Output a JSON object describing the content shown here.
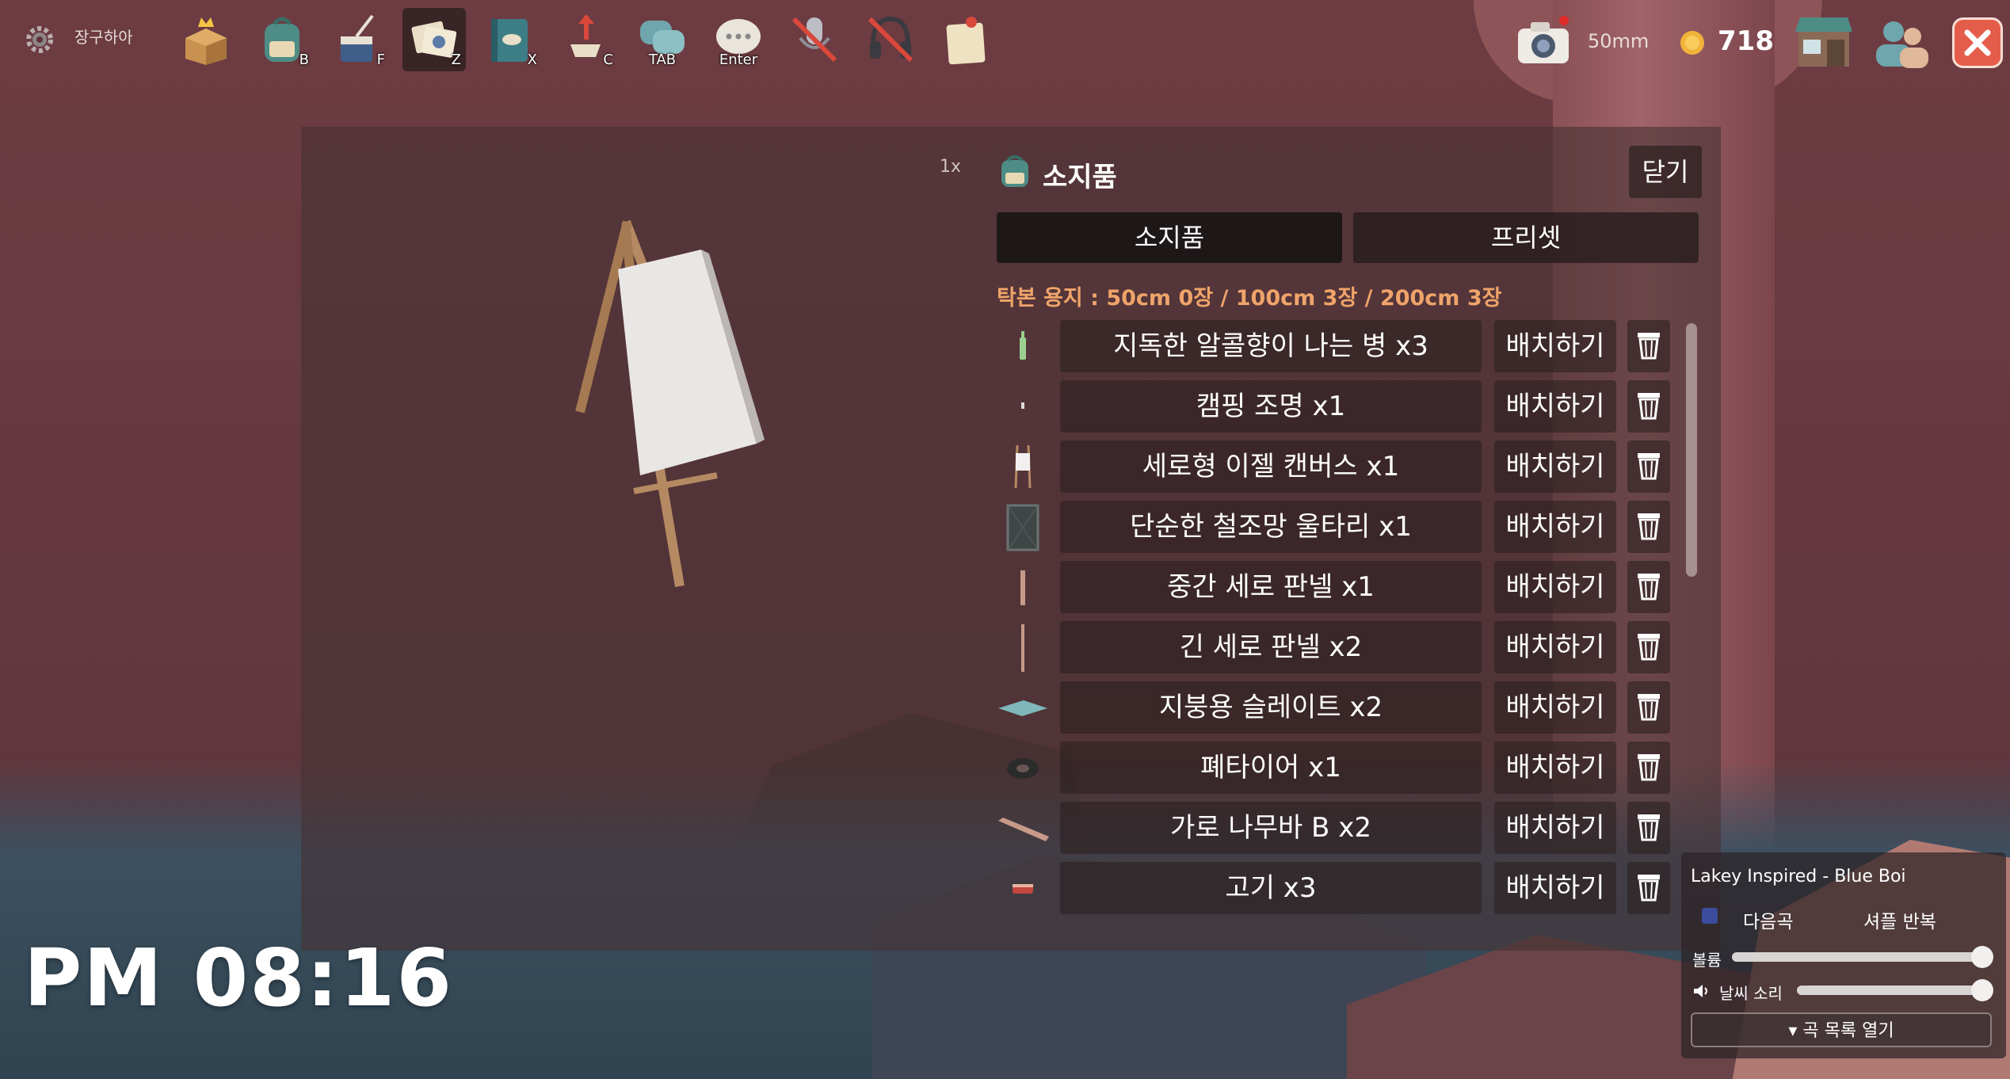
{
  "toolbar": {
    "settings_label": "장구하아",
    "buttons": [
      {
        "icon": "crown-box-icon",
        "key": ""
      },
      {
        "icon": "backpack-icon",
        "key": "B"
      },
      {
        "icon": "fishing-bucket-icon",
        "key": "F"
      },
      {
        "icon": "photo-album-icon",
        "key": "Z"
      },
      {
        "icon": "fish-encyclopedia-icon",
        "key": "X"
      },
      {
        "icon": "chair-move-icon",
        "key": "C"
      },
      {
        "icon": "chat-bubbles-icon",
        "key": "TAB"
      },
      {
        "icon": "speech-bubble-icon",
        "key": "Enter"
      },
      {
        "icon": "microphone-muted-icon",
        "key": ""
      },
      {
        "icon": "headphones-muted-icon",
        "key": ""
      },
      {
        "icon": "memo-pin-icon",
        "key": ""
      }
    ],
    "camera_label": "50mm",
    "coins": "718"
  },
  "preview": {
    "zoom": "1x"
  },
  "inventory": {
    "title": "소지품",
    "close_label": "닫기",
    "tabs": [
      "소지품",
      "프리셋"
    ],
    "rubbing_paper": "탁본 용지 : 50cm 0장 / 100cm 3장 / 200cm 3장",
    "place_label": "배치하기",
    "items": [
      {
        "name": "지독한 알콜향이 나는 병 x3",
        "thumb": "bottle-icon"
      },
      {
        "name": "캠핑 조명 x1",
        "thumb": "camping-light-icon"
      },
      {
        "name": "세로형 이젤 캔버스 x1",
        "thumb": "easel-icon"
      },
      {
        "name": "단순한 철조망 울타리 x1",
        "thumb": "wire-fence-icon"
      },
      {
        "name": "중간 세로 판넬 x1",
        "thumb": "mid-panel-icon"
      },
      {
        "name": "긴 세로 판넬 x2",
        "thumb": "long-panel-icon"
      },
      {
        "name": "지붕용 슬레이트 x2",
        "thumb": "slate-icon"
      },
      {
        "name": "폐타이어 x1",
        "thumb": "tire-icon"
      },
      {
        "name": "가로 나무바 B x2",
        "thumb": "wood-bar-icon"
      },
      {
        "name": "고기 x3",
        "thumb": "meat-icon"
      }
    ]
  },
  "clock": "PM 08:16",
  "music": {
    "song": "Lakey Inspired - Blue Boi",
    "next_label": "다음곡",
    "shuffle_label": "셔플 반복",
    "volume_label": "볼륨",
    "weather_label": "날씨 소리",
    "volume": 1.0,
    "weather_volume": 1.0,
    "playlist_label": "▾ 곡 목록 열기"
  },
  "colors": {
    "accent_orange": "#f0a46a",
    "close_red": "#e45d4a",
    "pause_blue": "#3b4c9c"
  }
}
